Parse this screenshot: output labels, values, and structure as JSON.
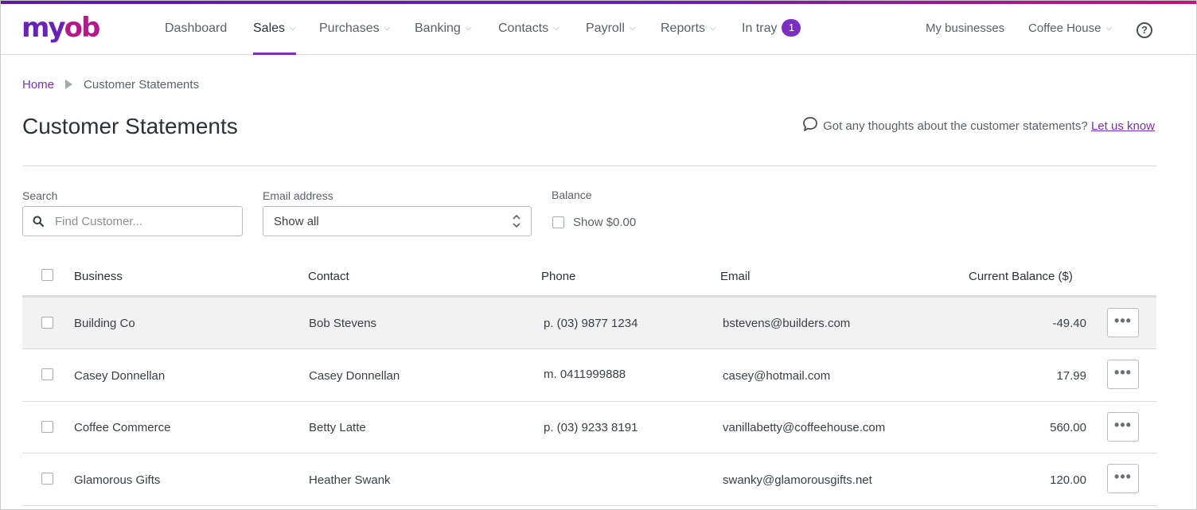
{
  "brand": {
    "logo_main": "my",
    "logo_accent": "ob"
  },
  "nav": {
    "items": [
      {
        "label": "Dashboard",
        "has_chevron": false
      },
      {
        "label": "Sales",
        "has_chevron": true
      },
      {
        "label": "Purchases",
        "has_chevron": true
      },
      {
        "label": "Banking",
        "has_chevron": true
      },
      {
        "label": "Contacts",
        "has_chevron": true
      },
      {
        "label": "Payroll",
        "has_chevron": true
      },
      {
        "label": "Reports",
        "has_chevron": true
      },
      {
        "label": "In tray",
        "has_chevron": false
      }
    ],
    "active": "Sales",
    "in_tray_count": "1",
    "my_businesses": "My businesses",
    "business_name": "Coffee House",
    "help_glyph": "?"
  },
  "breadcrumb": {
    "home": "Home",
    "current": "Customer Statements"
  },
  "page": {
    "title": "Customer Statements",
    "feedback_text": "Got any thoughts about the customer statements?",
    "feedback_link": "Let us know"
  },
  "filters": {
    "search_label": "Search",
    "search_placeholder": "Find Customer...",
    "search_value": "",
    "email_label": "Email address",
    "email_value": "Show all",
    "balance_label": "Balance",
    "balance_checkbox_label": "Show $0.00",
    "balance_checked": false
  },
  "table": {
    "columns": [
      "Business",
      "Contact",
      "Phone",
      "Email",
      "Current Balance ($)"
    ],
    "rows": [
      {
        "business": "Building Co",
        "contact": "Bob Stevens",
        "phone": "p. (03) 9877 1234",
        "email": "bstevens@builders.com",
        "balance": "-49.40",
        "highlighted": true
      },
      {
        "business": "Casey Donnellan",
        "contact": "Casey Donnellan",
        "phone": "m. 0411999888",
        "email": "casey@hotmail.com",
        "balance": "17.99",
        "highlighted": false
      },
      {
        "business": "Coffee Commerce",
        "contact": "Betty Latte",
        "phone": "p. (03) 9233 8191",
        "email": "vanillabetty@coffeehouse.com",
        "balance": "560.00",
        "highlighted": false
      },
      {
        "business": "Glamorous Gifts",
        "contact": "Heather Swank",
        "phone": "",
        "email": "swanky@glamorousgifts.net",
        "balance": "120.00",
        "highlighted": false
      }
    ],
    "row_action_glyph": "•••"
  },
  "colors": {
    "accent": "#7b2fc2",
    "brand_pink": "#b5188a",
    "row_highlight": "#f2f2f3"
  },
  "icons": {
    "search": "search-icon",
    "feedback": "speech-bubble-icon",
    "select": "up-down-chevron-icon",
    "help": "help-circle-icon"
  }
}
